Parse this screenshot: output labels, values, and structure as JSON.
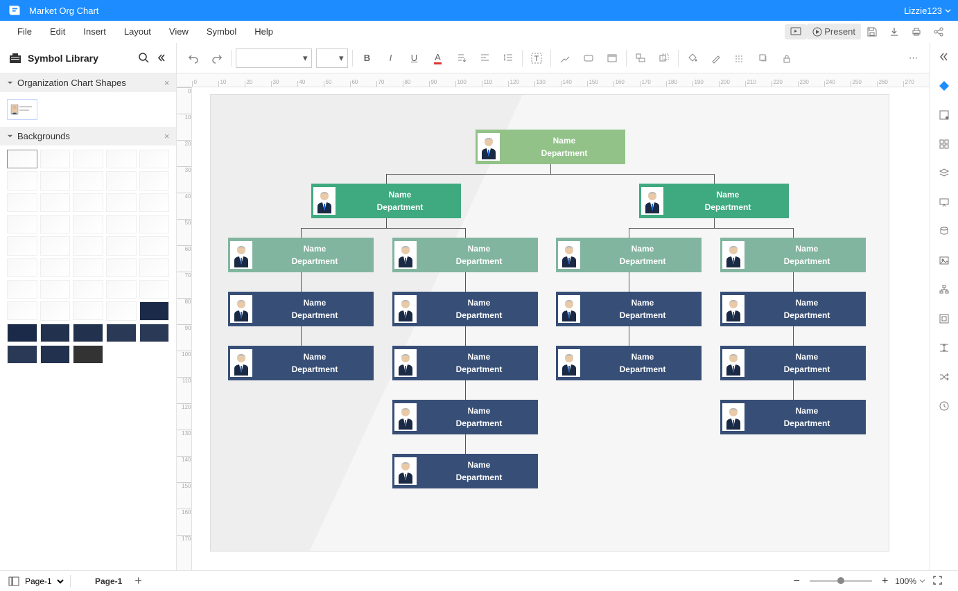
{
  "titlebar": {
    "app_title": "Market Org Chart",
    "user": "Lizzie123"
  },
  "menubar": {
    "items": [
      "File",
      "Edit",
      "Insert",
      "Layout",
      "View",
      "Symbol",
      "Help"
    ],
    "present_label": "Present"
  },
  "toolbar": {
    "font_family": "",
    "font_size": ""
  },
  "sidebar_left": {
    "title": "Symbol Library",
    "panels": {
      "org_shapes": "Organization Chart Shapes",
      "backgrounds": "Backgrounds"
    }
  },
  "ruler_ticks_h": [
    "0",
    "10",
    "20",
    "30",
    "40",
    "50",
    "60",
    "70",
    "80",
    "90",
    "100",
    "110",
    "120",
    "130",
    "140",
    "150",
    "160",
    "170",
    "180",
    "190",
    "200",
    "210",
    "220",
    "230",
    "240",
    "250",
    "260",
    "270"
  ],
  "ruler_ticks_v": [
    "0",
    "10",
    "20",
    "30",
    "40",
    "50",
    "60",
    "70",
    "80",
    "90",
    "100",
    "110",
    "120",
    "130",
    "140",
    "150",
    "160",
    "170"
  ],
  "node_text": {
    "name": "Name",
    "dept": "Department"
  },
  "statusbar": {
    "page_dropdown": "Page-1",
    "page_tab": "Page-1",
    "zoom": "100%"
  }
}
